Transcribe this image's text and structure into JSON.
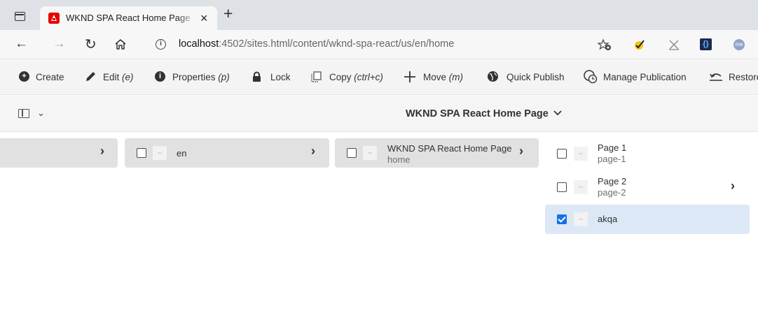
{
  "browser": {
    "tab_title": "WKND SPA React Home Page | A",
    "tab_close": "×",
    "new_tab": "+",
    "url_host": "localhost",
    "url_path": ":4502/sites.html/content/wknd-spa-react/us/en/home",
    "profile": "me"
  },
  "toolbar": {
    "items": [
      {
        "label": "Create",
        "shortcut": "",
        "icon": "plus-circle-icon"
      },
      {
        "label": "Edit",
        "shortcut": "(e)",
        "icon": "pencil-icon"
      },
      {
        "label": "Properties",
        "shortcut": "(p)",
        "icon": "info-circle-icon"
      },
      {
        "label": "Lock",
        "shortcut": "",
        "icon": "lock-icon"
      },
      {
        "label": "Copy",
        "shortcut": "(ctrl+c)",
        "icon": "copy-icon"
      },
      {
        "label": "Move",
        "shortcut": "(m)",
        "icon": "move-icon"
      },
      {
        "label": "Quick Publish",
        "shortcut": "",
        "icon": "globe-icon"
      },
      {
        "label": "Manage Publication",
        "shortcut": "",
        "icon": "globe-clock-icon"
      },
      {
        "label": "Restore",
        "shortcut": "",
        "icon": "restore-icon"
      }
    ]
  },
  "header": {
    "page_title": "WKND SPA React Home Page"
  },
  "columns": {
    "col2": {
      "title": "en"
    },
    "col3": {
      "title": "WKND SPA React Home Page",
      "name": "home"
    },
    "col4": [
      {
        "title": "Page 1",
        "name": "page-1",
        "checked": false,
        "has_children": false
      },
      {
        "title": "Page 2",
        "name": "page-2",
        "checked": false,
        "has_children": true
      },
      {
        "title": "akqa",
        "name": "",
        "checked": true,
        "has_children": false
      }
    ]
  },
  "colors": {
    "accent": "#1473e6",
    "selected_row": "#dce8f5",
    "active_column": "#e1e1e1",
    "adobe_red": "#e60000"
  }
}
